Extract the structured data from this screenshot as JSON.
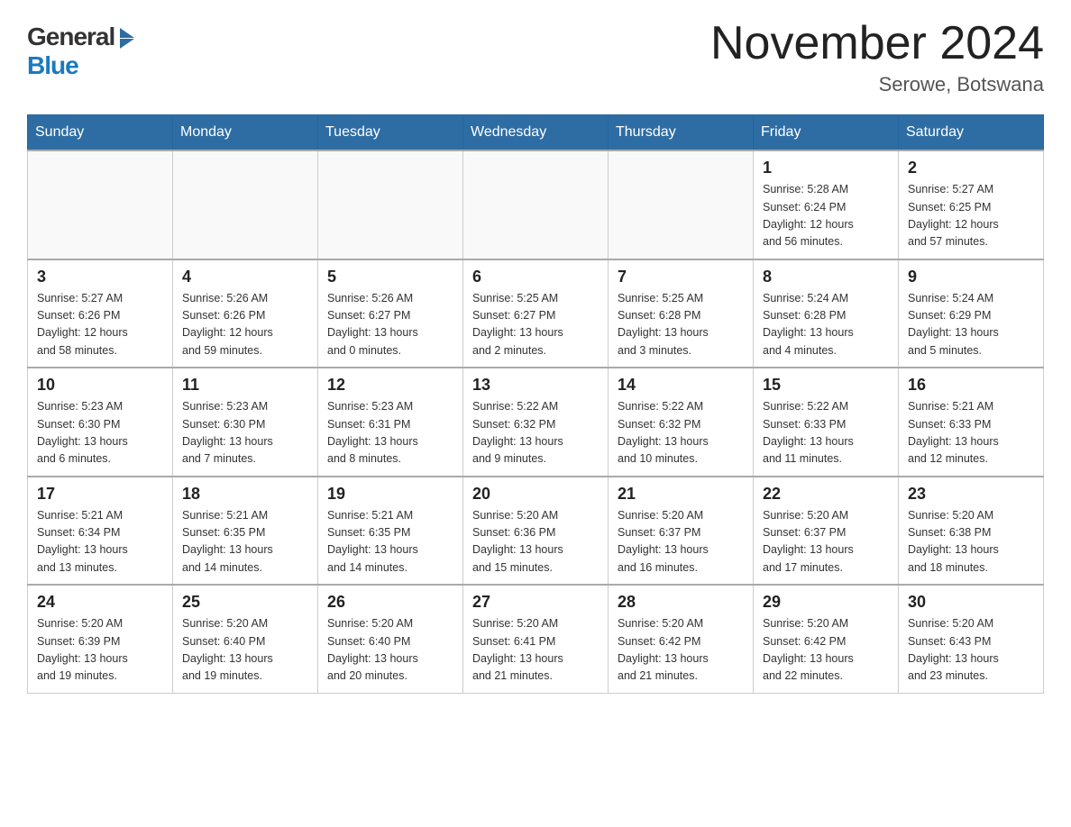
{
  "header": {
    "logo_general": "General",
    "logo_blue": "Blue",
    "month_title": "November 2024",
    "location": "Serowe, Botswana"
  },
  "weekdays": [
    "Sunday",
    "Monday",
    "Tuesday",
    "Wednesday",
    "Thursday",
    "Friday",
    "Saturday"
  ],
  "weeks": [
    [
      {
        "day": "",
        "info": ""
      },
      {
        "day": "",
        "info": ""
      },
      {
        "day": "",
        "info": ""
      },
      {
        "day": "",
        "info": ""
      },
      {
        "day": "",
        "info": ""
      },
      {
        "day": "1",
        "info": "Sunrise: 5:28 AM\nSunset: 6:24 PM\nDaylight: 12 hours\nand 56 minutes."
      },
      {
        "day": "2",
        "info": "Sunrise: 5:27 AM\nSunset: 6:25 PM\nDaylight: 12 hours\nand 57 minutes."
      }
    ],
    [
      {
        "day": "3",
        "info": "Sunrise: 5:27 AM\nSunset: 6:26 PM\nDaylight: 12 hours\nand 58 minutes."
      },
      {
        "day": "4",
        "info": "Sunrise: 5:26 AM\nSunset: 6:26 PM\nDaylight: 12 hours\nand 59 minutes."
      },
      {
        "day": "5",
        "info": "Sunrise: 5:26 AM\nSunset: 6:27 PM\nDaylight: 13 hours\nand 0 minutes."
      },
      {
        "day": "6",
        "info": "Sunrise: 5:25 AM\nSunset: 6:27 PM\nDaylight: 13 hours\nand 2 minutes."
      },
      {
        "day": "7",
        "info": "Sunrise: 5:25 AM\nSunset: 6:28 PM\nDaylight: 13 hours\nand 3 minutes."
      },
      {
        "day": "8",
        "info": "Sunrise: 5:24 AM\nSunset: 6:28 PM\nDaylight: 13 hours\nand 4 minutes."
      },
      {
        "day": "9",
        "info": "Sunrise: 5:24 AM\nSunset: 6:29 PM\nDaylight: 13 hours\nand 5 minutes."
      }
    ],
    [
      {
        "day": "10",
        "info": "Sunrise: 5:23 AM\nSunset: 6:30 PM\nDaylight: 13 hours\nand 6 minutes."
      },
      {
        "day": "11",
        "info": "Sunrise: 5:23 AM\nSunset: 6:30 PM\nDaylight: 13 hours\nand 7 minutes."
      },
      {
        "day": "12",
        "info": "Sunrise: 5:23 AM\nSunset: 6:31 PM\nDaylight: 13 hours\nand 8 minutes."
      },
      {
        "day": "13",
        "info": "Sunrise: 5:22 AM\nSunset: 6:32 PM\nDaylight: 13 hours\nand 9 minutes."
      },
      {
        "day": "14",
        "info": "Sunrise: 5:22 AM\nSunset: 6:32 PM\nDaylight: 13 hours\nand 10 minutes."
      },
      {
        "day": "15",
        "info": "Sunrise: 5:22 AM\nSunset: 6:33 PM\nDaylight: 13 hours\nand 11 minutes."
      },
      {
        "day": "16",
        "info": "Sunrise: 5:21 AM\nSunset: 6:33 PM\nDaylight: 13 hours\nand 12 minutes."
      }
    ],
    [
      {
        "day": "17",
        "info": "Sunrise: 5:21 AM\nSunset: 6:34 PM\nDaylight: 13 hours\nand 13 minutes."
      },
      {
        "day": "18",
        "info": "Sunrise: 5:21 AM\nSunset: 6:35 PM\nDaylight: 13 hours\nand 14 minutes."
      },
      {
        "day": "19",
        "info": "Sunrise: 5:21 AM\nSunset: 6:35 PM\nDaylight: 13 hours\nand 14 minutes."
      },
      {
        "day": "20",
        "info": "Sunrise: 5:20 AM\nSunset: 6:36 PM\nDaylight: 13 hours\nand 15 minutes."
      },
      {
        "day": "21",
        "info": "Sunrise: 5:20 AM\nSunset: 6:37 PM\nDaylight: 13 hours\nand 16 minutes."
      },
      {
        "day": "22",
        "info": "Sunrise: 5:20 AM\nSunset: 6:37 PM\nDaylight: 13 hours\nand 17 minutes."
      },
      {
        "day": "23",
        "info": "Sunrise: 5:20 AM\nSunset: 6:38 PM\nDaylight: 13 hours\nand 18 minutes."
      }
    ],
    [
      {
        "day": "24",
        "info": "Sunrise: 5:20 AM\nSunset: 6:39 PM\nDaylight: 13 hours\nand 19 minutes."
      },
      {
        "day": "25",
        "info": "Sunrise: 5:20 AM\nSunset: 6:40 PM\nDaylight: 13 hours\nand 19 minutes."
      },
      {
        "day": "26",
        "info": "Sunrise: 5:20 AM\nSunset: 6:40 PM\nDaylight: 13 hours\nand 20 minutes."
      },
      {
        "day": "27",
        "info": "Sunrise: 5:20 AM\nSunset: 6:41 PM\nDaylight: 13 hours\nand 21 minutes."
      },
      {
        "day": "28",
        "info": "Sunrise: 5:20 AM\nSunset: 6:42 PM\nDaylight: 13 hours\nand 21 minutes."
      },
      {
        "day": "29",
        "info": "Sunrise: 5:20 AM\nSunset: 6:42 PM\nDaylight: 13 hours\nand 22 minutes."
      },
      {
        "day": "30",
        "info": "Sunrise: 5:20 AM\nSunset: 6:43 PM\nDaylight: 13 hours\nand 23 minutes."
      }
    ]
  ]
}
